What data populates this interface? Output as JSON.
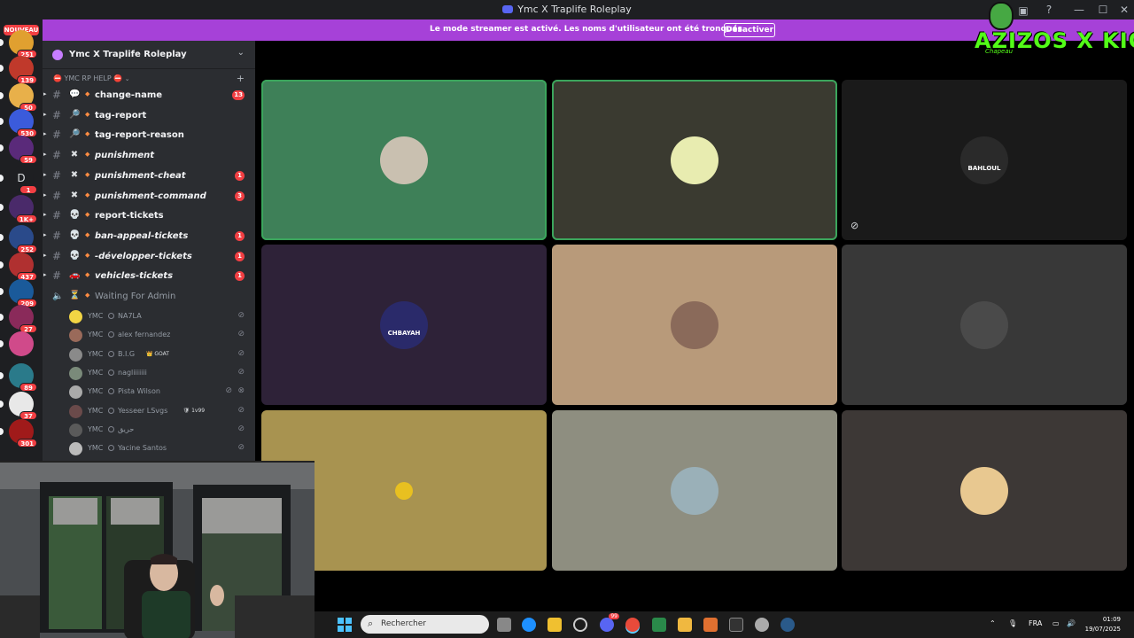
{
  "window": {
    "title": "Ymc X Traplife Roleplay",
    "controls": {
      "minimize": "—",
      "maximize": "☐",
      "close": "✕"
    }
  },
  "banner": {
    "message": "Le mode streamer est activé. Les noms d'utilisateur ont été tronqués.",
    "button": "Désactiver"
  },
  "rail": {
    "new_label": "NOUVEAU",
    "servers": [
      {
        "badge": "251",
        "color": "#e0a030"
      },
      {
        "badge": "139",
        "color": "#c0392b"
      },
      {
        "badge": "50",
        "color": "#e8b04a"
      },
      {
        "badge": "530",
        "color": "#3b5bdb"
      },
      {
        "badge": "59",
        "color": "#5a2a7a"
      },
      {
        "badge": "1",
        "letter": "D",
        "color": "#1e1f22"
      },
      {
        "badge": "1K+",
        "color": "#4a2a6a"
      },
      {
        "badge": "252",
        "color": "#2a4a8a"
      },
      {
        "badge": "437",
        "color": "#b03030"
      },
      {
        "badge": "209",
        "color": "#1a5a9a"
      },
      {
        "badge": "27",
        "color": "#8a2a5a"
      },
      {
        "badge": "",
        "color": "#d04a8a"
      },
      {
        "badge": "89",
        "color": "#2a7a8a"
      },
      {
        "badge": "37",
        "color": "#e8e8e8"
      },
      {
        "badge": "301",
        "color": "#a01a1a"
      }
    ]
  },
  "sidebar": {
    "server_name": "Ymc X Traplife Roleplay",
    "category": "YMC RP HELP",
    "channels": [
      {
        "label": "change-name",
        "emoji": "💬",
        "badge": "13",
        "italic": false
      },
      {
        "label": "tag-report",
        "emoji": "🔎",
        "badge": "",
        "italic": false
      },
      {
        "label": "tag-report-reason",
        "emoji": "🔎",
        "badge": "",
        "italic": false
      },
      {
        "label": "punishment",
        "emoji": "✖",
        "badge": "",
        "italic": true
      },
      {
        "label": "punishment-cheat",
        "emoji": "✖",
        "badge": "1",
        "italic": true
      },
      {
        "label": "punishment-command",
        "emoji": "✖",
        "badge": "3",
        "italic": true
      },
      {
        "label": "report-tickets",
        "emoji": "💀",
        "badge": "",
        "italic": false
      },
      {
        "label": "ban-appeal-tickets",
        "emoji": "💀",
        "badge": "1",
        "italic": true
      },
      {
        "label": "-développer-tickets",
        "emoji": "💀",
        "badge": "1",
        "italic": true
      },
      {
        "label": "vehicles-tickets",
        "emoji": "🚗",
        "badge": "1",
        "italic": true
      }
    ],
    "voice_channel": {
      "label": "Waiting For Admin",
      "emoji": "⏳"
    },
    "voice_users": [
      {
        "tag": "YMC",
        "name": "NA7LA",
        "extra": "",
        "color": "#f2d544",
        "deaf": false
      },
      {
        "tag": "YMC",
        "name": "alex fernandez",
        "extra": "",
        "color": "#9a6a5a",
        "deaf": false
      },
      {
        "tag": "YMC",
        "name": "B.I.G",
        "extra": "👑 GOAT",
        "color": "#8a8a8a",
        "deaf": false
      },
      {
        "tag": "YMC",
        "name": "nagliiiiiii",
        "extra": "",
        "color": "#7a8a7a",
        "deaf": false
      },
      {
        "tag": "YMC",
        "name": "Pista Wilson",
        "extra": "",
        "color": "#aaaaaa",
        "deaf": true
      },
      {
        "tag": "YMC",
        "name": "Yesseer LSvgs",
        "extra": "🛡 1v99",
        "color": "#6a4a4a",
        "deaf": false
      },
      {
        "tag": "YMC",
        "name": "حريق",
        "extra": "",
        "color": "#5a5a5a",
        "deaf": false
      },
      {
        "tag": "YMC",
        "name": "Yacine Santos",
        "extra": "",
        "color": "#bbbbbb",
        "deaf": false
      }
    ]
  },
  "call": {
    "tiles": [
      {
        "bg": "#3e8058",
        "speaking": true,
        "avatar_color": "#c9c0b0",
        "avatar_label": ""
      },
      {
        "bg": "#3a3a30",
        "speaking": true,
        "avatar_color": "#e8ecb0",
        "avatar_label": ""
      },
      {
        "bg": "#1a1a1a",
        "speaking": false,
        "avatar_color": "#2a2a2a",
        "avatar_label": "BAHLOUL",
        "cam_off": true
      },
      {
        "bg": "#2e2238",
        "speaking": false,
        "avatar_color": "#2a2a6a",
        "avatar_label": "CHBAYAH"
      },
      {
        "bg": "#b89a7a",
        "speaking": false,
        "avatar_color": "#8a6a5a",
        "avatar_label": ""
      },
      {
        "bg": "#383838",
        "speaking": false,
        "avatar_color": "#4a4a4a",
        "avatar_label": ""
      },
      {
        "bg": "#a89350",
        "speaking": false,
        "avatar_color": "#a89350",
        "avatar_label": ""
      },
      {
        "bg": "#8e8e80",
        "speaking": false,
        "avatar_color": "#9ab0b8",
        "avatar_label": ""
      },
      {
        "bg": "#3d3836",
        "speaking": false,
        "avatar_color": "#e8c890",
        "avatar_label": ""
      }
    ]
  },
  "overlay": {
    "kick_text": "AZIZOS X KICK",
    "kick_sub": "Chapeau"
  },
  "taskbar": {
    "search_placeholder": "Rechercher",
    "lang": "FRA",
    "time": "01:09",
    "date": "19/07/2025",
    "discord_badge": "99"
  },
  "colors": {
    "accent": "#5865f2",
    "banner": "#a641d8",
    "speaking": "#3ba55c",
    "badge": "#f23f43"
  }
}
